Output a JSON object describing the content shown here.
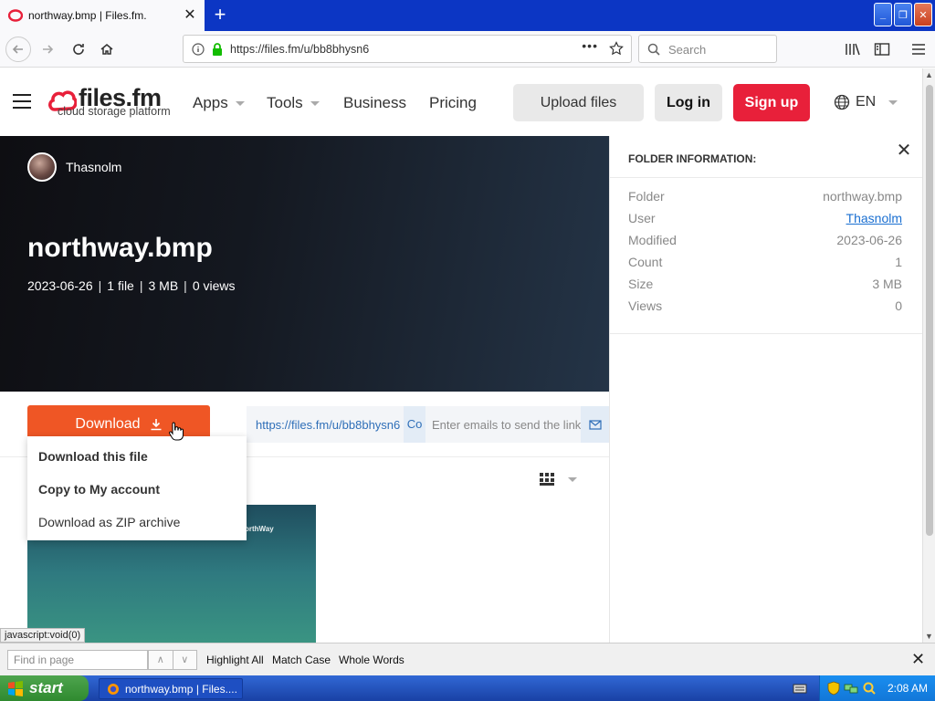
{
  "browser": {
    "tab_title": "northway.bmp | Files.fm.",
    "url": "https://files.fm/u/bb8bhysn6",
    "search_placeholder": "Search"
  },
  "header": {
    "logo_name": "files.fm",
    "logo_tagline": "cloud storage platform",
    "menu": [
      "Apps",
      "Tools",
      "Business",
      "Pricing"
    ],
    "upload_label": "Upload files",
    "login_label": "Log in",
    "signup_label": "Sign up",
    "language": "EN",
    "accent_color": "#e8203a"
  },
  "hero": {
    "username": "Thasnolm",
    "title": "northway.bmp",
    "date": "2023-06-26",
    "files": "1 file",
    "size": "3 MB",
    "views": "0 views"
  },
  "panel": {
    "heading": "FOLDER INFORMATION:",
    "rows": [
      {
        "label": "Folder",
        "value": "northway.bmp"
      },
      {
        "label": "User",
        "value": "Thasnolm"
      },
      {
        "label": "Modified",
        "value": "2023-06-26"
      },
      {
        "label": "Count",
        "value": "1"
      },
      {
        "label": "Size",
        "value": "3 MB"
      },
      {
        "label": "Views",
        "value": "0"
      }
    ]
  },
  "actions": {
    "download_label": "Download",
    "download_color": "#ef5625",
    "share_link": "https://files.fm/u/bb8bhysn6",
    "copy_label": "Co",
    "email_placeholder": "Enter emails to send the link"
  },
  "download_menu": [
    "Download this file",
    "Copy to My account",
    "Download as ZIP archive"
  ],
  "thumbnail_text": "orthWay",
  "status_tip": "javascript:void(0)",
  "findbar": {
    "placeholder": "Find in page",
    "highlight_all": "Highlight All",
    "match_case": "Match Case",
    "whole_words": "Whole Words"
  },
  "taskbar": {
    "start_label": "start",
    "task_label": "northway.bmp | Files....",
    "clock": "2:08 AM"
  }
}
